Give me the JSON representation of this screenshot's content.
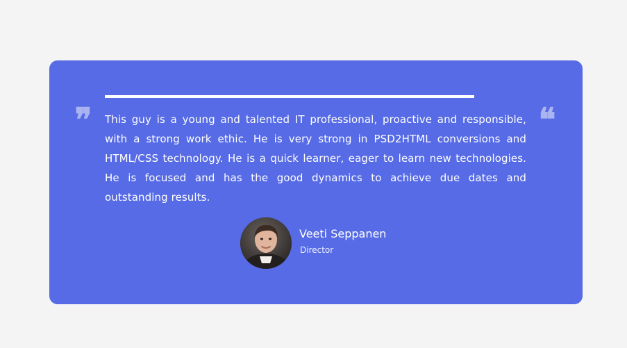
{
  "testimonial": {
    "open_quote": "❞",
    "close_quote": "❝",
    "text": "This guy is a young and talented IT professional, proactive and responsible, with a strong work ethic. He is very strong in PSD2HTML conversions and HTML/CSS technology. He is a quick learner, eager to learn new technologies. He is focused and has the good dynamics to achieve due dates and outstanding results.",
    "author": {
      "name": "Veeti Seppanen",
      "role": "Director"
    }
  },
  "colors": {
    "page_background": "#f4f4f4",
    "card_background": "#566be5",
    "quote_mark": "#a9b4f1",
    "text": "#ffffff"
  }
}
